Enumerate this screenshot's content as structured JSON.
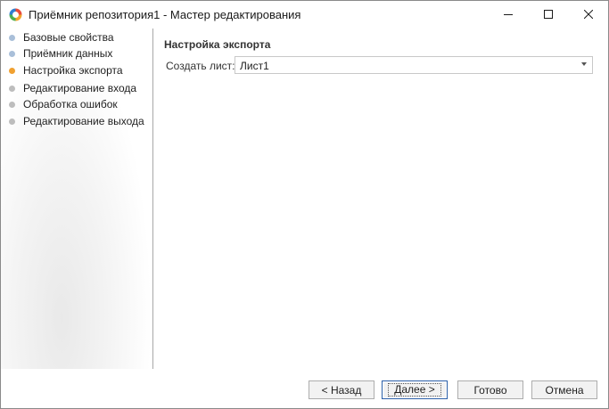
{
  "window": {
    "title": "Приёмник репозитория1 - Мастер редактирования"
  },
  "steps": [
    {
      "label": "Базовые свойства",
      "color": "#a9bfd9"
    },
    {
      "label": "Приёмник данных",
      "color": "#a9bfd9"
    },
    {
      "label": "Настройка экспорта",
      "color": "#f0a030"
    },
    {
      "label": "Редактирование входа",
      "color": "#bdbdbd"
    },
    {
      "label": "Обработка ошибок",
      "color": "#bdbdbd"
    },
    {
      "label": "Редактирование выхода",
      "color": "#bdbdbd"
    }
  ],
  "content": {
    "section_title": "Настройка экспорта",
    "create_sheet_label": "Создать лист:",
    "create_sheet_value": "Лист1"
  },
  "buttons": {
    "back": "< Назад",
    "next": "Далее >",
    "done": "Готово",
    "cancel": "Отмена"
  },
  "icons": {
    "app": "app-logo-icon",
    "minimize": "minimize-icon",
    "maximize": "maximize-icon",
    "close": "close-icon",
    "dropdown": "chevron-down-icon"
  }
}
